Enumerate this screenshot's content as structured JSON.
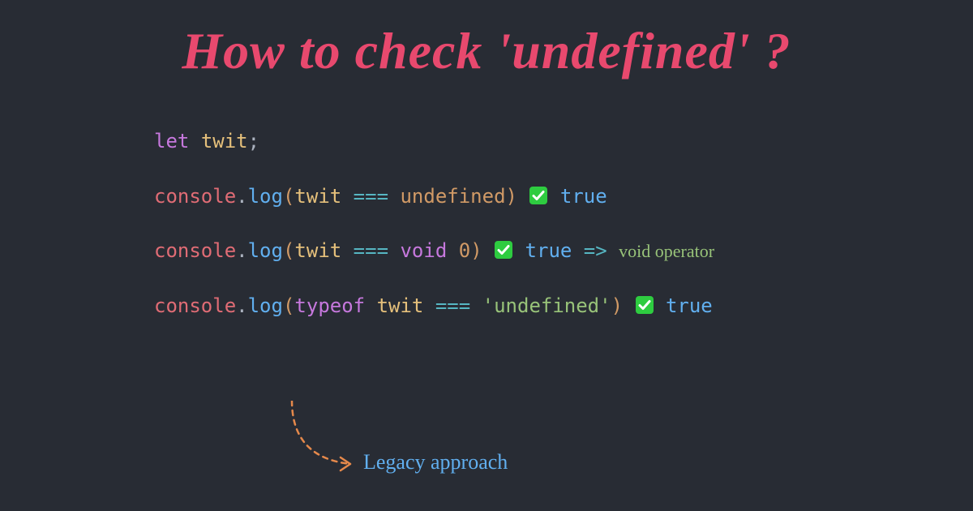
{
  "title": "How to check 'undefined' ?",
  "code": {
    "let": "let",
    "varname": "twit",
    "semi": ";",
    "console": "console",
    "dot": ".",
    "log": "log",
    "lparen": "(",
    "rparen": ")",
    "eqeqeq": "===",
    "undefined": "undefined",
    "void": "void",
    "zero": "0",
    "typeof": "typeof",
    "str_undef": "'undefined'",
    "true": "true",
    "arrow": "=>",
    "void_note": "void operator"
  },
  "legacy": "Legacy approach"
}
